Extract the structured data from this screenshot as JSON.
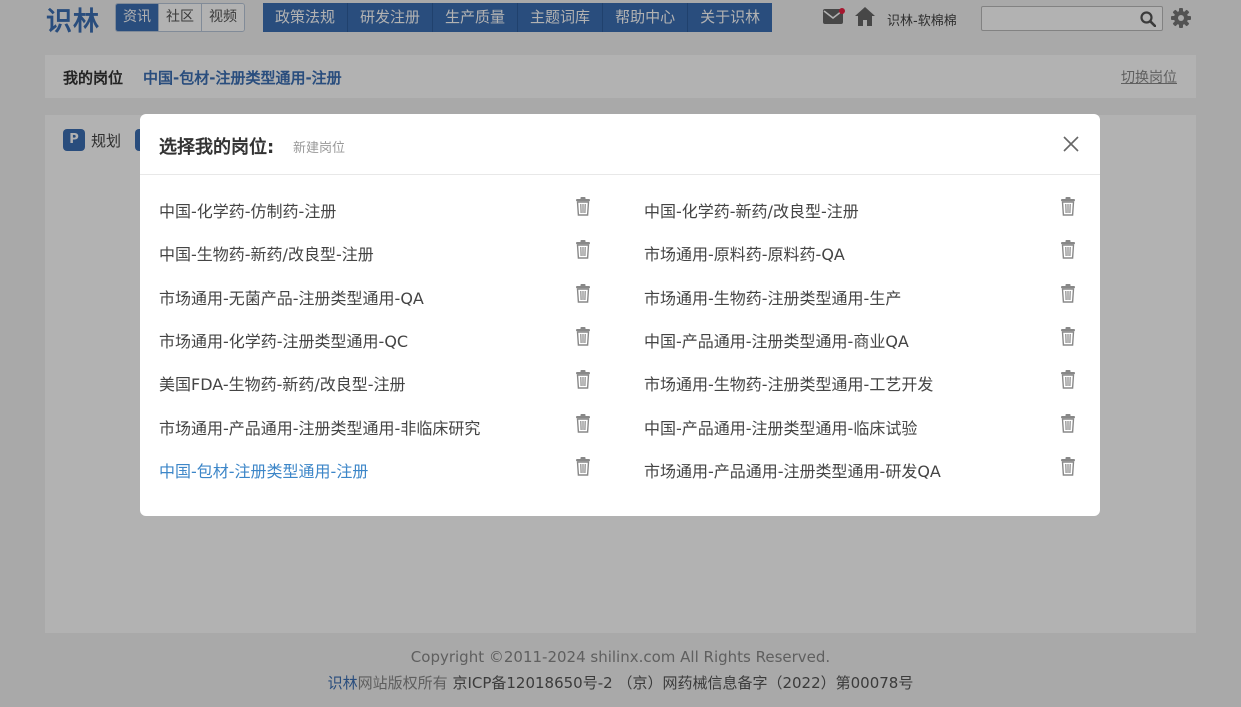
{
  "header": {
    "logo": "识林",
    "subnav": [
      "资讯",
      "社区",
      "视频"
    ],
    "mainnav": [
      "政策法规",
      "研发注册",
      "生产质量",
      "主题词库",
      "帮助中心",
      "关于识林"
    ],
    "username": "识林-软棉棉",
    "search_placeholder": ""
  },
  "post_bar": {
    "label": "我的岗位",
    "value": "中国-包材-注册类型通用-注册",
    "switch": "切换岗位"
  },
  "content": {
    "plan_badge": "P",
    "plan_label": "规划"
  },
  "modal": {
    "title": "选择我的岗位:",
    "new_post": "新建岗位",
    "current": "中国-包材-注册类型通用-注册",
    "posts_left": [
      "中国-化学药-仿制药-注册",
      "中国-生物药-新药/改良型-注册",
      "市场通用-无菌产品-注册类型通用-QA",
      "市场通用-化学药-注册类型通用-QC",
      "美国FDA-生物药-新药/改良型-注册",
      "市场通用-产品通用-注册类型通用-非临床研究",
      "中国-包材-注册类型通用-注册"
    ],
    "posts_right": [
      "中国-化学药-新药/改良型-注册",
      "市场通用-原料药-原料药-QA",
      "市场通用-生物药-注册类型通用-生产",
      "中国-产品通用-注册类型通用-商业QA",
      "市场通用-生物药-注册类型通用-工艺开发",
      "中国-产品通用-注册类型通用-临床试验",
      "市场通用-产品通用-注册类型通用-研发QA"
    ]
  },
  "footer": {
    "copyright": "Copyright ©2011-2024 shilinx.com All Rights Reserved.",
    "brand": "识林",
    "rights": "网站版权所有",
    "icp": " 京ICP备12018650号-2 （京）网药械信息备字（2022）第00078号"
  },
  "colors": {
    "brand": "#3c6fb4",
    "current_post": "#3c86c8"
  }
}
